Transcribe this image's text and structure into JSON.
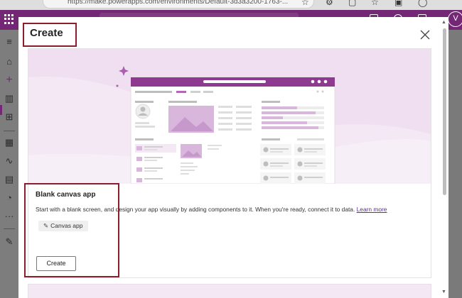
{
  "browser": {
    "url": "https://make.powerapps.com/environments/Default-3d3a3200-1763-..."
  },
  "appbar": {
    "avatar_initial": "V"
  },
  "dialog": {
    "title": "Create",
    "close_label": "Close"
  },
  "card": {
    "title": "Blank canvas app",
    "description": "Start with a blank screen, and design your app visually by adding components to it. When you're ready, connect it to data.",
    "learn_more": "Learn more",
    "tag": "Canvas app",
    "create_label": "Create"
  },
  "colors": {
    "brand": "#742774",
    "annotation_border": "#8b1e2d",
    "hero_bg": "#f3e8f4"
  }
}
